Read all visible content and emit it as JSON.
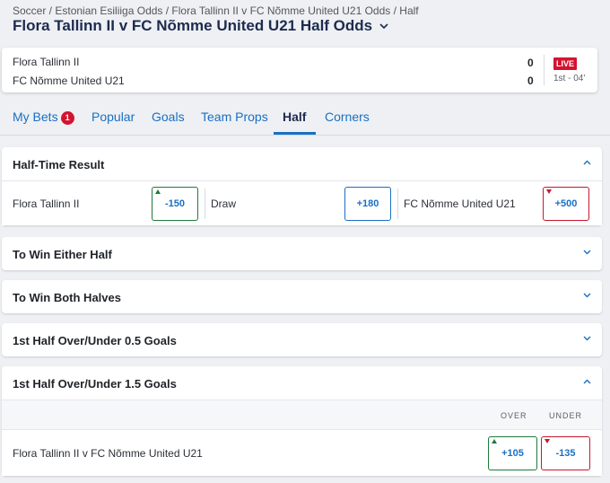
{
  "breadcrumb": "Soccer / Estonian Esiliiga Odds / Flora Tallinn II v FC Nõmme United U21 Odds / Half",
  "page_title": "Flora Tallinn II v FC Nõmme United U21 Half Odds",
  "scoreboard": {
    "home_team": "Flora Tallinn II",
    "away_team": "FC Nõmme United U21",
    "home_score": "0",
    "away_score": "0",
    "live_label": "LIVE",
    "time": "1st - 04'"
  },
  "tabs": [
    {
      "label": "My Bets",
      "badge": "1"
    },
    {
      "label": "Popular"
    },
    {
      "label": "Goals"
    },
    {
      "label": "Team Props"
    },
    {
      "label": "Half",
      "active": true
    },
    {
      "label": "Corners"
    }
  ],
  "markets": [
    {
      "title": "Half-Time Result",
      "expanded": true,
      "selections": [
        {
          "label": "Flora Tallinn II",
          "odds": "-150",
          "trend": "up"
        },
        {
          "label": "Draw",
          "odds": "+180",
          "trend": "none"
        },
        {
          "label": "FC Nõmme United U21",
          "odds": "+500",
          "trend": "down"
        }
      ]
    },
    {
      "title": "To Win Either Half",
      "expanded": false
    },
    {
      "title": "To Win Both Halves",
      "expanded": false
    },
    {
      "title": "1st Half Over/Under 0.5 Goals",
      "expanded": false
    },
    {
      "title": "1st Half Over/Under 1.5 Goals",
      "expanded": true,
      "columns": [
        "OVER",
        "UNDER"
      ],
      "row": {
        "label": "Flora Tallinn II v FC Nõmme United U21",
        "over": "+105",
        "over_trend": "up",
        "under": "-135",
        "under_trend": "down"
      }
    }
  ],
  "colors": {
    "accent": "#1a6fc4",
    "title": "#1d2b4f",
    "live": "#d3142f",
    "up": "#1e7a3c",
    "down": "#c4192e"
  },
  "icons": [
    "chevron-down-icon",
    "chevron-up-icon",
    "odds-up-arrow-icon",
    "odds-down-arrow-icon"
  ]
}
